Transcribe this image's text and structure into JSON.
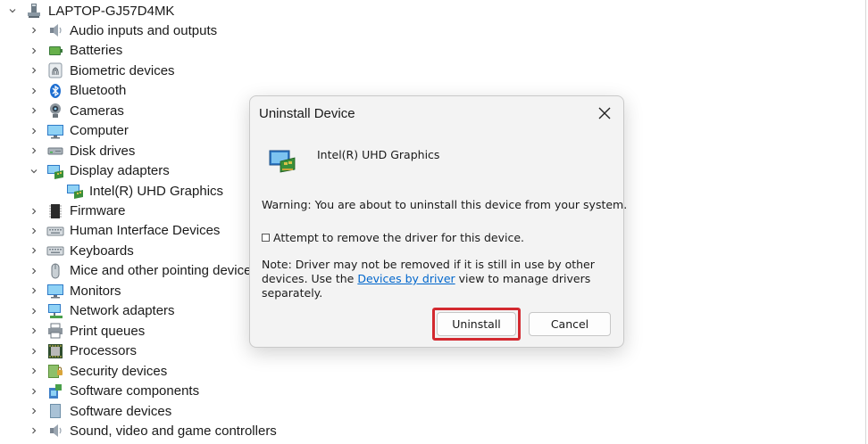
{
  "tree": {
    "root": {
      "label": "LAPTOP-GJ57D4MK",
      "icon": "computer-icon"
    },
    "items": [
      {
        "label": "Audio inputs and outputs",
        "icon": "speaker-icon",
        "expanded": false
      },
      {
        "label": "Batteries",
        "icon": "battery-icon",
        "expanded": false
      },
      {
        "label": "Biometric devices",
        "icon": "fingerprint-icon",
        "expanded": false
      },
      {
        "label": "Bluetooth",
        "icon": "bluetooth-icon",
        "expanded": false
      },
      {
        "label": "Cameras",
        "icon": "camera-icon",
        "expanded": false
      },
      {
        "label": "Computer",
        "icon": "monitor-icon",
        "expanded": false
      },
      {
        "label": "Disk drives",
        "icon": "disk-drive-icon",
        "expanded": false
      },
      {
        "label": "Display adapters",
        "icon": "display-adapter-icon",
        "expanded": true
      },
      {
        "label": "Intel(R) UHD Graphics",
        "icon": "display-adapter-icon",
        "child": true
      },
      {
        "label": "Firmware",
        "icon": "chip-icon",
        "expanded": false
      },
      {
        "label": "Human Interface Devices",
        "icon": "keyboard-icon",
        "expanded": false
      },
      {
        "label": "Keyboards",
        "icon": "keyboard-icon",
        "expanded": false
      },
      {
        "label": "Mice and other pointing devices",
        "icon": "mouse-icon",
        "expanded": false
      },
      {
        "label": "Monitors",
        "icon": "monitor-icon",
        "expanded": false
      },
      {
        "label": "Network adapters",
        "icon": "network-icon",
        "expanded": false
      },
      {
        "label": "Print queues",
        "icon": "printer-icon",
        "expanded": false
      },
      {
        "label": "Processors",
        "icon": "processor-icon",
        "expanded": false
      },
      {
        "label": "Security devices",
        "icon": "security-icon",
        "expanded": false
      },
      {
        "label": "Software components",
        "icon": "software-component-icon",
        "expanded": false
      },
      {
        "label": "Software devices",
        "icon": "software-device-icon",
        "expanded": false
      },
      {
        "label": "Sound, video and game controllers",
        "icon": "speaker-icon",
        "expanded": false
      }
    ]
  },
  "dialog": {
    "title": "Uninstall Device",
    "device_name": "Intel(R) UHD Graphics",
    "warning": "Warning: You are about to uninstall this device from your system.",
    "checkbox_label": "Attempt to remove the driver for this device.",
    "checkbox_checked": false,
    "note_before": "Note: Driver may not be removed if it is still in use by other devices. Use the ",
    "note_link": "Devices by driver",
    "note_after": " view to manage drivers separately.",
    "uninstall_label": "Uninstall",
    "cancel_label": "Cancel",
    "highlight_color": "#d3292f"
  }
}
